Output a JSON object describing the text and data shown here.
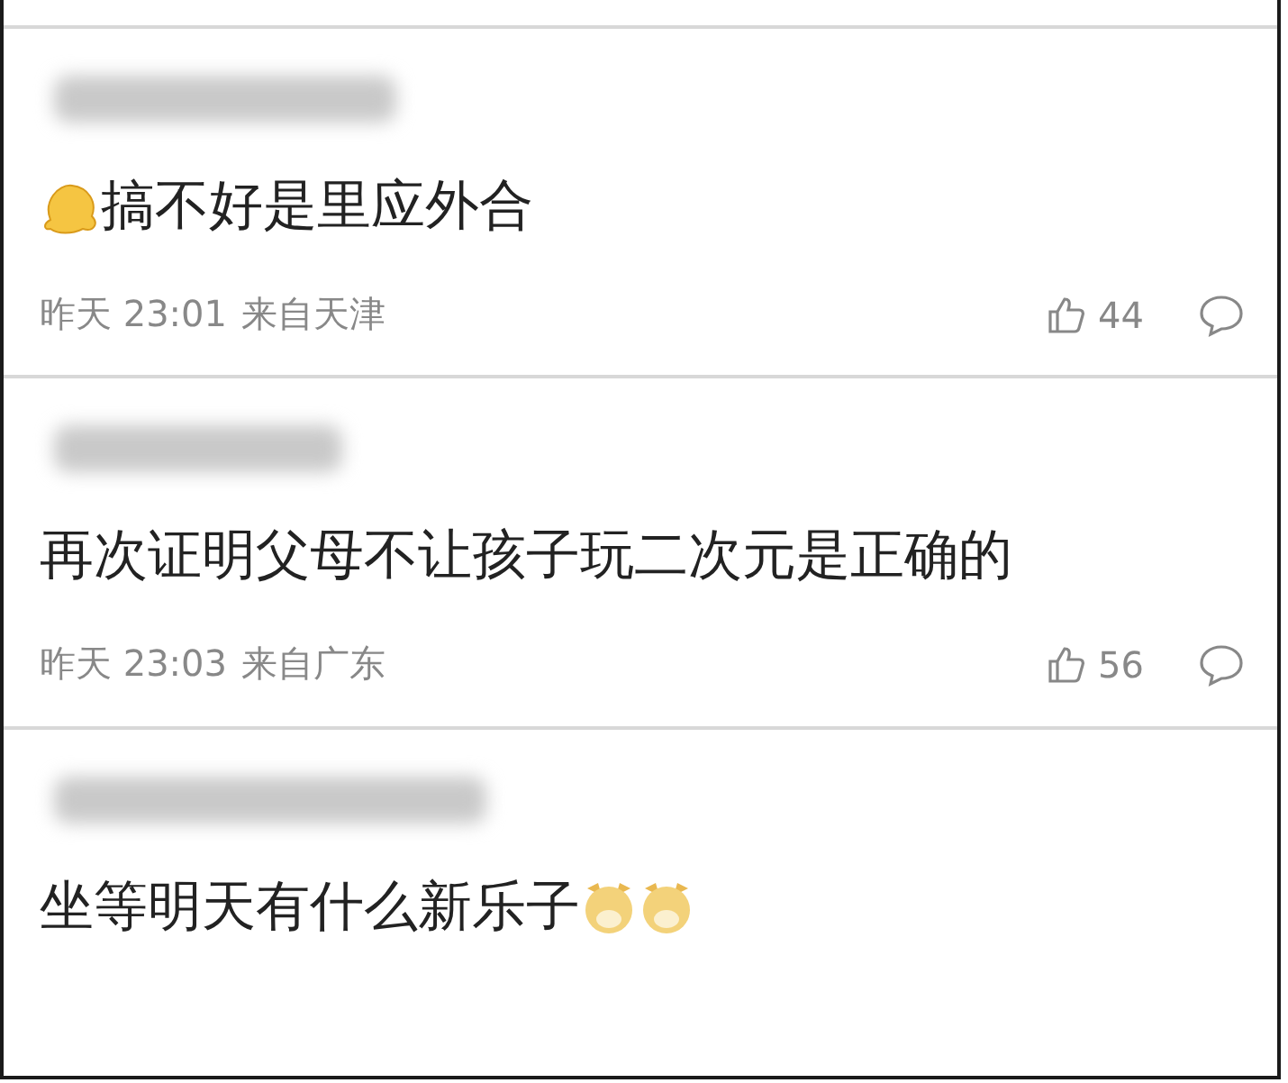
{
  "comments": [
    {
      "emojis_before": [
        {
          "kind": "blob"
        }
      ],
      "text": "搞不好是里应外合",
      "time": "昨天 23:01",
      "location": "来自天津",
      "likes": "44"
    },
    {
      "text": "再次证明父母不让孩子玩二次元是正确的",
      "time": "昨天 23:03",
      "location": "来自广东",
      "likes": "56"
    },
    {
      "text": "坐等明天有什么新乐子",
      "emojis_after": [
        {
          "kind": "dog"
        },
        {
          "kind": "dog"
        }
      ]
    }
  ]
}
